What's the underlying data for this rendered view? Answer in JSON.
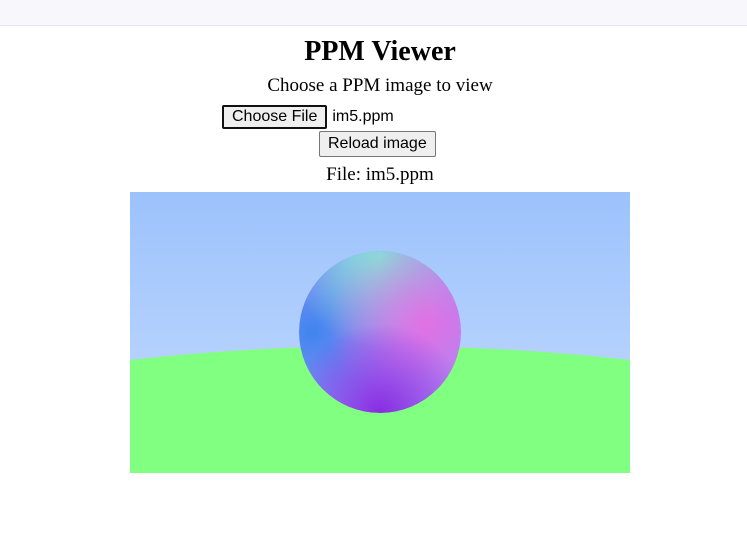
{
  "page": {
    "title": "PPM Viewer",
    "subtitle": "Choose a PPM image to view"
  },
  "file_input": {
    "button_label": "Choose File",
    "selected_file": "im5.ppm"
  },
  "reload": {
    "label": "Reload image"
  },
  "file_info": {
    "label": "File: im5.ppm"
  },
  "render": {
    "sky_top_color": "#9cc2fc",
    "sky_bottom_color": "#c6dcfe",
    "ground_color": "#80ff80",
    "sphere_colors": [
      "#7fe7d6",
      "#5b6cf7",
      "#a98cf8",
      "#ef66e0",
      "#8a2be2"
    ]
  }
}
